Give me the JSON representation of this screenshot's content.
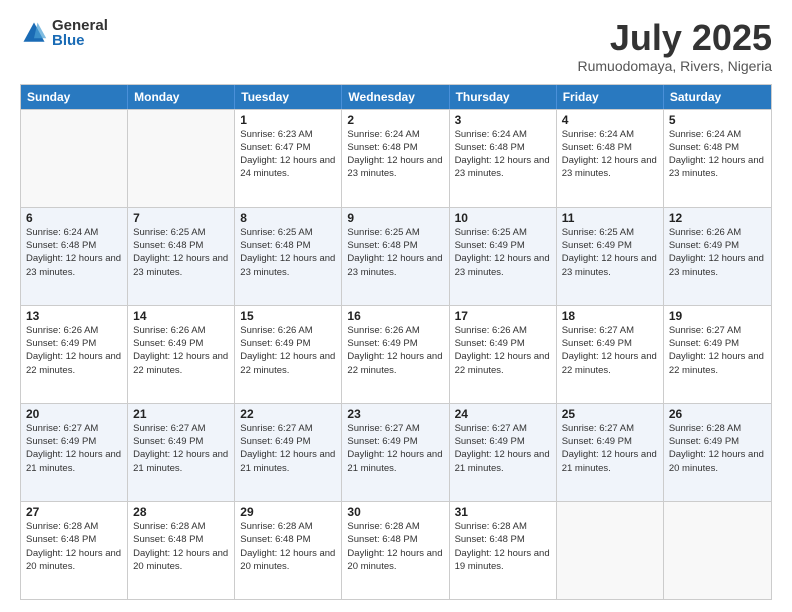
{
  "header": {
    "logo_general": "General",
    "logo_blue": "Blue",
    "month_title": "July 2025",
    "location": "Rumuodomaya, Rivers, Nigeria"
  },
  "calendar": {
    "days_of_week": [
      "Sunday",
      "Monday",
      "Tuesday",
      "Wednesday",
      "Thursday",
      "Friday",
      "Saturday"
    ],
    "rows": [
      [
        {
          "day": "",
          "empty": true
        },
        {
          "day": "",
          "empty": true
        },
        {
          "day": "1",
          "sunrise": "Sunrise: 6:23 AM",
          "sunset": "Sunset: 6:47 PM",
          "daylight": "Daylight: 12 hours and 24 minutes."
        },
        {
          "day": "2",
          "sunrise": "Sunrise: 6:24 AM",
          "sunset": "Sunset: 6:48 PM",
          "daylight": "Daylight: 12 hours and 23 minutes."
        },
        {
          "day": "3",
          "sunrise": "Sunrise: 6:24 AM",
          "sunset": "Sunset: 6:48 PM",
          "daylight": "Daylight: 12 hours and 23 minutes."
        },
        {
          "day": "4",
          "sunrise": "Sunrise: 6:24 AM",
          "sunset": "Sunset: 6:48 PM",
          "daylight": "Daylight: 12 hours and 23 minutes."
        },
        {
          "day": "5",
          "sunrise": "Sunrise: 6:24 AM",
          "sunset": "Sunset: 6:48 PM",
          "daylight": "Daylight: 12 hours and 23 minutes."
        }
      ],
      [
        {
          "day": "6",
          "sunrise": "Sunrise: 6:24 AM",
          "sunset": "Sunset: 6:48 PM",
          "daylight": "Daylight: 12 hours and 23 minutes."
        },
        {
          "day": "7",
          "sunrise": "Sunrise: 6:25 AM",
          "sunset": "Sunset: 6:48 PM",
          "daylight": "Daylight: 12 hours and 23 minutes."
        },
        {
          "day": "8",
          "sunrise": "Sunrise: 6:25 AM",
          "sunset": "Sunset: 6:48 PM",
          "daylight": "Daylight: 12 hours and 23 minutes."
        },
        {
          "day": "9",
          "sunrise": "Sunrise: 6:25 AM",
          "sunset": "Sunset: 6:48 PM",
          "daylight": "Daylight: 12 hours and 23 minutes."
        },
        {
          "day": "10",
          "sunrise": "Sunrise: 6:25 AM",
          "sunset": "Sunset: 6:49 PM",
          "daylight": "Daylight: 12 hours and 23 minutes."
        },
        {
          "day": "11",
          "sunrise": "Sunrise: 6:25 AM",
          "sunset": "Sunset: 6:49 PM",
          "daylight": "Daylight: 12 hours and 23 minutes."
        },
        {
          "day": "12",
          "sunrise": "Sunrise: 6:26 AM",
          "sunset": "Sunset: 6:49 PM",
          "daylight": "Daylight: 12 hours and 23 minutes."
        }
      ],
      [
        {
          "day": "13",
          "sunrise": "Sunrise: 6:26 AM",
          "sunset": "Sunset: 6:49 PM",
          "daylight": "Daylight: 12 hours and 22 minutes."
        },
        {
          "day": "14",
          "sunrise": "Sunrise: 6:26 AM",
          "sunset": "Sunset: 6:49 PM",
          "daylight": "Daylight: 12 hours and 22 minutes."
        },
        {
          "day": "15",
          "sunrise": "Sunrise: 6:26 AM",
          "sunset": "Sunset: 6:49 PM",
          "daylight": "Daylight: 12 hours and 22 minutes."
        },
        {
          "day": "16",
          "sunrise": "Sunrise: 6:26 AM",
          "sunset": "Sunset: 6:49 PM",
          "daylight": "Daylight: 12 hours and 22 minutes."
        },
        {
          "day": "17",
          "sunrise": "Sunrise: 6:26 AM",
          "sunset": "Sunset: 6:49 PM",
          "daylight": "Daylight: 12 hours and 22 minutes."
        },
        {
          "day": "18",
          "sunrise": "Sunrise: 6:27 AM",
          "sunset": "Sunset: 6:49 PM",
          "daylight": "Daylight: 12 hours and 22 minutes."
        },
        {
          "day": "19",
          "sunrise": "Sunrise: 6:27 AM",
          "sunset": "Sunset: 6:49 PM",
          "daylight": "Daylight: 12 hours and 22 minutes."
        }
      ],
      [
        {
          "day": "20",
          "sunrise": "Sunrise: 6:27 AM",
          "sunset": "Sunset: 6:49 PM",
          "daylight": "Daylight: 12 hours and 21 minutes."
        },
        {
          "day": "21",
          "sunrise": "Sunrise: 6:27 AM",
          "sunset": "Sunset: 6:49 PM",
          "daylight": "Daylight: 12 hours and 21 minutes."
        },
        {
          "day": "22",
          "sunrise": "Sunrise: 6:27 AM",
          "sunset": "Sunset: 6:49 PM",
          "daylight": "Daylight: 12 hours and 21 minutes."
        },
        {
          "day": "23",
          "sunrise": "Sunrise: 6:27 AM",
          "sunset": "Sunset: 6:49 PM",
          "daylight": "Daylight: 12 hours and 21 minutes."
        },
        {
          "day": "24",
          "sunrise": "Sunrise: 6:27 AM",
          "sunset": "Sunset: 6:49 PM",
          "daylight": "Daylight: 12 hours and 21 minutes."
        },
        {
          "day": "25",
          "sunrise": "Sunrise: 6:27 AM",
          "sunset": "Sunset: 6:49 PM",
          "daylight": "Daylight: 12 hours and 21 minutes."
        },
        {
          "day": "26",
          "sunrise": "Sunrise: 6:28 AM",
          "sunset": "Sunset: 6:49 PM",
          "daylight": "Daylight: 12 hours and 20 minutes."
        }
      ],
      [
        {
          "day": "27",
          "sunrise": "Sunrise: 6:28 AM",
          "sunset": "Sunset: 6:48 PM",
          "daylight": "Daylight: 12 hours and 20 minutes."
        },
        {
          "day": "28",
          "sunrise": "Sunrise: 6:28 AM",
          "sunset": "Sunset: 6:48 PM",
          "daylight": "Daylight: 12 hours and 20 minutes."
        },
        {
          "day": "29",
          "sunrise": "Sunrise: 6:28 AM",
          "sunset": "Sunset: 6:48 PM",
          "daylight": "Daylight: 12 hours and 20 minutes."
        },
        {
          "day": "30",
          "sunrise": "Sunrise: 6:28 AM",
          "sunset": "Sunset: 6:48 PM",
          "daylight": "Daylight: 12 hours and 20 minutes."
        },
        {
          "day": "31",
          "sunrise": "Sunrise: 6:28 AM",
          "sunset": "Sunset: 6:48 PM",
          "daylight": "Daylight: 12 hours and 19 minutes."
        },
        {
          "day": "",
          "empty": true
        },
        {
          "day": "",
          "empty": true
        }
      ]
    ]
  }
}
